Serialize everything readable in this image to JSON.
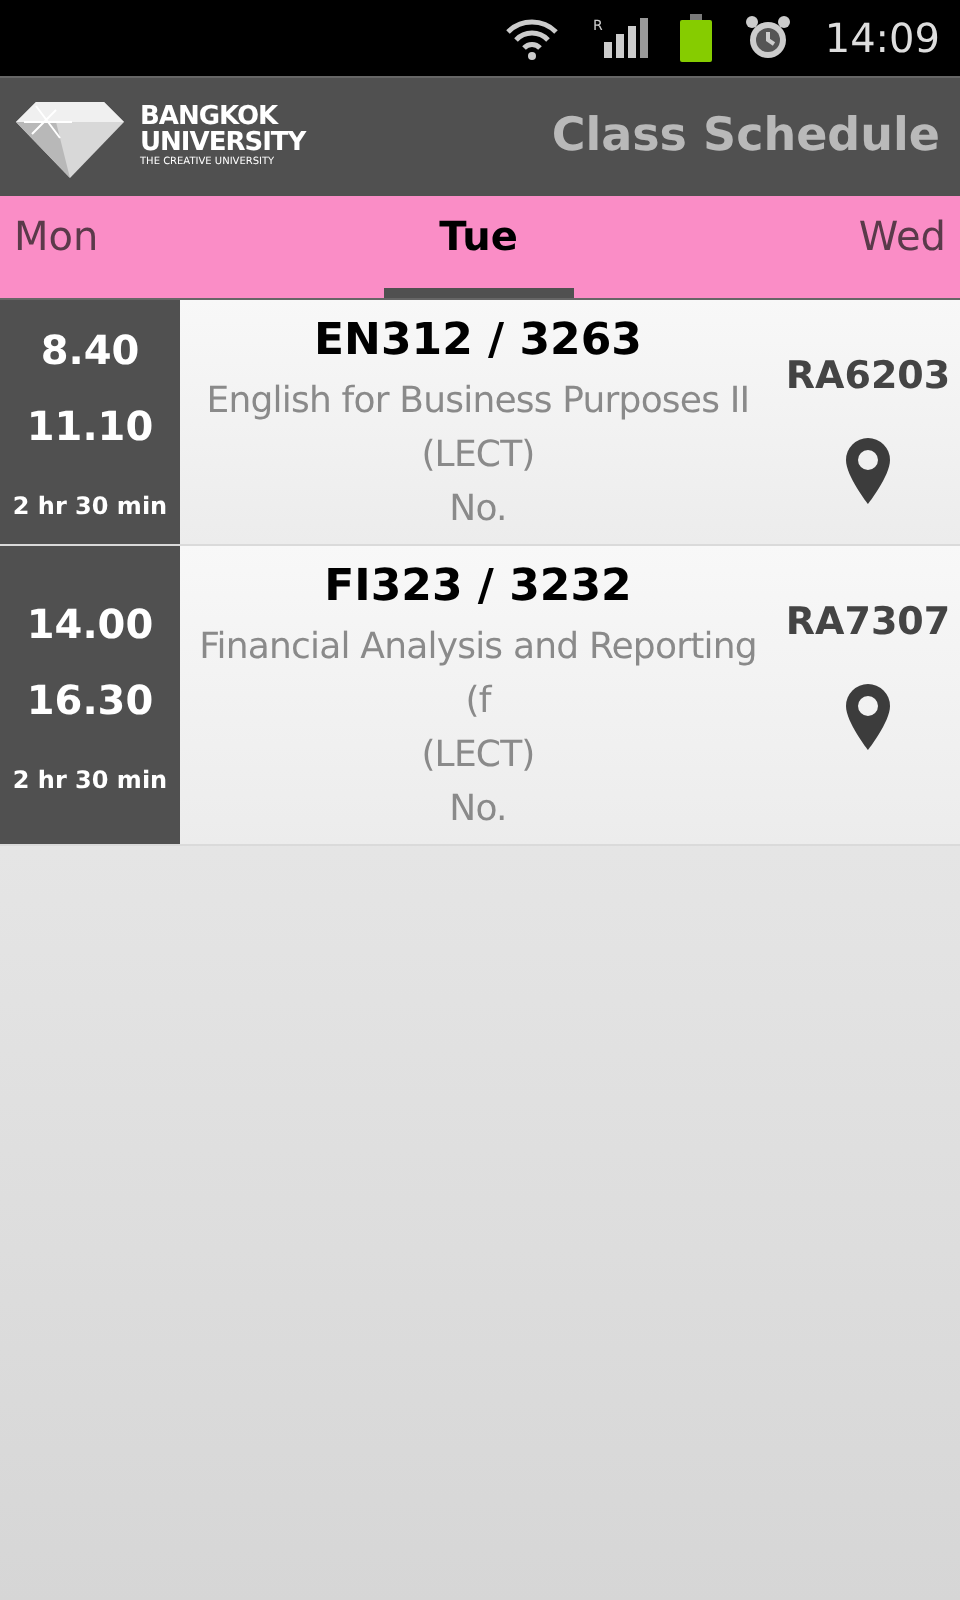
{
  "status_bar": {
    "time": "14:09",
    "signal_roaming": "R"
  },
  "app_bar": {
    "logo": {
      "name": "BANGKOK",
      "name2": "UNIVERSITY",
      "tagline": "THE CREATIVE UNIVERSITY"
    },
    "title": "Class Schedule"
  },
  "tabs": [
    {
      "label": "Mon",
      "selected": false
    },
    {
      "label": "Tue",
      "selected": true
    },
    {
      "label": "Wed",
      "selected": false
    }
  ],
  "classes": [
    {
      "start": "8.40",
      "end": "11.10",
      "duration": "2 hr 30 min",
      "code": "EN312 / 3263",
      "title": "English for Business Purposes II",
      "type": "(LECT)",
      "note": "No.",
      "room": "RA6203"
    },
    {
      "start": "14.00",
      "end": "16.30",
      "duration": "2 hr 30 min",
      "code": "FI323 / 3232",
      "title": "Financial Analysis and Reporting (f",
      "type": "(LECT)",
      "note": "No.",
      "room": "RA7307"
    }
  ]
}
